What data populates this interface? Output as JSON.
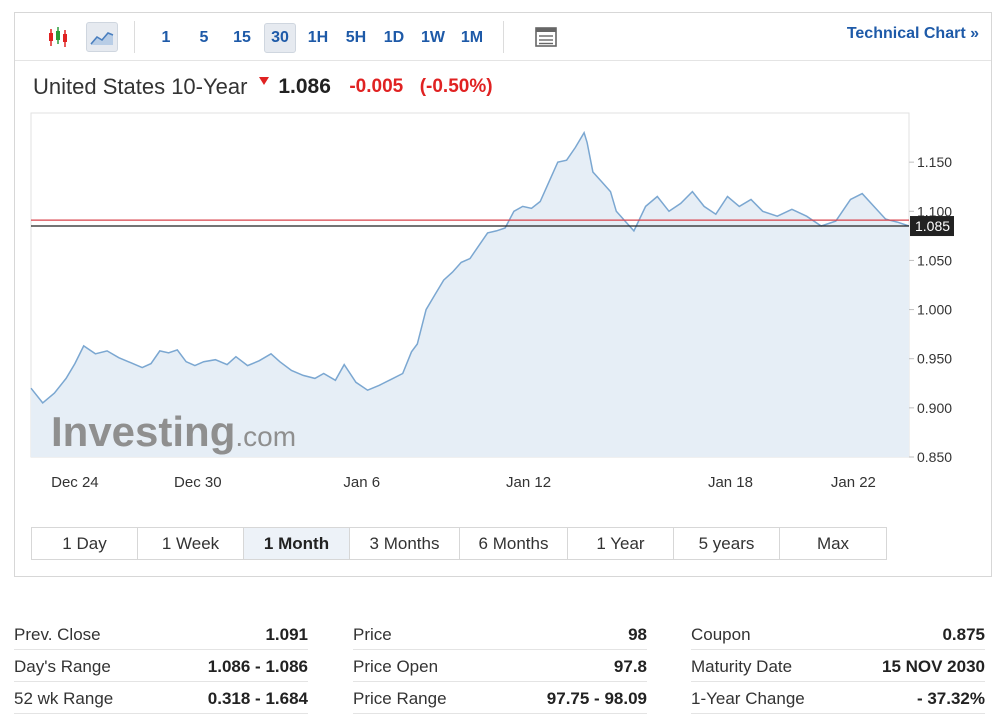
{
  "toolbar": {
    "intervals": [
      "1",
      "5",
      "15",
      "30",
      "1H",
      "5H",
      "1D",
      "1W",
      "1M"
    ],
    "active_interval": "30",
    "technical_chart": "Technical Chart »"
  },
  "quote": {
    "name": "United States 10-Year",
    "price": "1.086",
    "change": "-0.005",
    "change_pct": "(-0.50%)"
  },
  "colors": {
    "accent": "#1e5aa8",
    "negative": "#e02222",
    "line": "#7ba7d1",
    "area": "#e6eef6",
    "prev_close_line": "#d9434c",
    "current_line": "#222222"
  },
  "watermark": {
    "brand": "Investing",
    "suffix": ".com"
  },
  "chart_data": {
    "type": "area",
    "ylim": [
      0.85,
      1.2
    ],
    "yticks": [
      0.85,
      0.9,
      0.95,
      1.0,
      1.05,
      1.1,
      1.15
    ],
    "ytick_labels": [
      "0.850",
      "0.900",
      "0.950",
      "1.000",
      "1.050",
      "1.100",
      "1.150"
    ],
    "xticks": [
      {
        "label": "Dec 24",
        "x": 0.5
      },
      {
        "label": "Dec 30",
        "x": 4.7
      },
      {
        "label": "Jan 6",
        "x": 10.3
      },
      {
        "label": "Jan 12",
        "x": 16.0
      },
      {
        "label": "Jan 18",
        "x": 22.9
      },
      {
        "label": "Jan 22",
        "x": 27.1
      }
    ],
    "xlim": [
      -1.0,
      29.0
    ],
    "points": [
      [
        -1.0,
        0.92
      ],
      [
        -0.6,
        0.905
      ],
      [
        -0.2,
        0.915
      ],
      [
        0.2,
        0.93
      ],
      [
        0.5,
        0.945
      ],
      [
        0.8,
        0.963
      ],
      [
        1.2,
        0.955
      ],
      [
        1.6,
        0.958
      ],
      [
        2.0,
        0.951
      ],
      [
        2.4,
        0.946
      ],
      [
        2.8,
        0.941
      ],
      [
        3.1,
        0.945
      ],
      [
        3.4,
        0.958
      ],
      [
        3.7,
        0.956
      ],
      [
        4.0,
        0.959
      ],
      [
        4.3,
        0.947
      ],
      [
        4.6,
        0.943
      ],
      [
        4.9,
        0.947
      ],
      [
        5.3,
        0.949
      ],
      [
        5.7,
        0.944
      ],
      [
        6.0,
        0.952
      ],
      [
        6.4,
        0.943
      ],
      [
        6.8,
        0.948
      ],
      [
        7.2,
        0.955
      ],
      [
        7.5,
        0.947
      ],
      [
        7.9,
        0.938
      ],
      [
        8.3,
        0.933
      ],
      [
        8.7,
        0.93
      ],
      [
        9.0,
        0.935
      ],
      [
        9.4,
        0.928
      ],
      [
        9.7,
        0.944
      ],
      [
        10.1,
        0.926
      ],
      [
        10.5,
        0.918
      ],
      [
        10.9,
        0.923
      ],
      [
        11.3,
        0.929
      ],
      [
        11.7,
        0.935
      ],
      [
        12.0,
        0.957
      ],
      [
        12.2,
        0.965
      ],
      [
        12.5,
        1.0
      ],
      [
        12.8,
        1.015
      ],
      [
        13.1,
        1.03
      ],
      [
        13.4,
        1.038
      ],
      [
        13.7,
        1.048
      ],
      [
        14.0,
        1.052
      ],
      [
        14.3,
        1.065
      ],
      [
        14.6,
        1.078
      ],
      [
        14.9,
        1.08
      ],
      [
        15.2,
        1.083
      ],
      [
        15.5,
        1.1
      ],
      [
        15.8,
        1.105
      ],
      [
        16.1,
        1.103
      ],
      [
        16.4,
        1.11
      ],
      [
        16.7,
        1.13
      ],
      [
        17.0,
        1.15
      ],
      [
        17.3,
        1.152
      ],
      [
        17.6,
        1.165
      ],
      [
        17.9,
        1.18
      ],
      [
        18.0,
        1.17
      ],
      [
        18.2,
        1.14
      ],
      [
        18.5,
        1.13
      ],
      [
        18.8,
        1.12
      ],
      [
        19.0,
        1.1
      ],
      [
        19.3,
        1.09
      ],
      [
        19.6,
        1.08
      ],
      [
        20.0,
        1.105
      ],
      [
        20.4,
        1.115
      ],
      [
        20.8,
        1.1
      ],
      [
        21.2,
        1.108
      ],
      [
        21.6,
        1.12
      ],
      [
        22.0,
        1.105
      ],
      [
        22.4,
        1.097
      ],
      [
        22.8,
        1.115
      ],
      [
        23.2,
        1.105
      ],
      [
        23.6,
        1.112
      ],
      [
        24.0,
        1.1
      ],
      [
        24.5,
        1.095
      ],
      [
        25.0,
        1.102
      ],
      [
        25.5,
        1.095
      ],
      [
        26.0,
        1.085
      ],
      [
        26.5,
        1.09
      ],
      [
        27.0,
        1.112
      ],
      [
        27.4,
        1.118
      ],
      [
        27.8,
        1.105
      ],
      [
        28.2,
        1.092
      ],
      [
        28.6,
        1.089
      ],
      [
        29.0,
        1.085
      ]
    ],
    "prev_close": 1.091,
    "current": 1.085,
    "current_label": "1.085"
  },
  "ranges": [
    "1 Day",
    "1 Week",
    "1 Month",
    "3 Months",
    "6 Months",
    "1 Year",
    "5 years",
    "Max"
  ],
  "active_range": "1 Month",
  "stats": [
    [
      {
        "label": "Prev. Close",
        "value": "1.091"
      },
      {
        "label": "Day's Range",
        "value": "1.086 - 1.086"
      },
      {
        "label": "52 wk Range",
        "value": "0.318 - 1.684"
      }
    ],
    [
      {
        "label": "Price",
        "value": "98"
      },
      {
        "label": "Price Open",
        "value": "97.8"
      },
      {
        "label": "Price Range",
        "value": "97.75 - 98.09"
      }
    ],
    [
      {
        "label": "Coupon",
        "value": "0.875"
      },
      {
        "label": "Maturity Date",
        "value": "15 NOV 2030"
      },
      {
        "label": "1-Year Change",
        "value": "- 37.32%"
      }
    ]
  ]
}
